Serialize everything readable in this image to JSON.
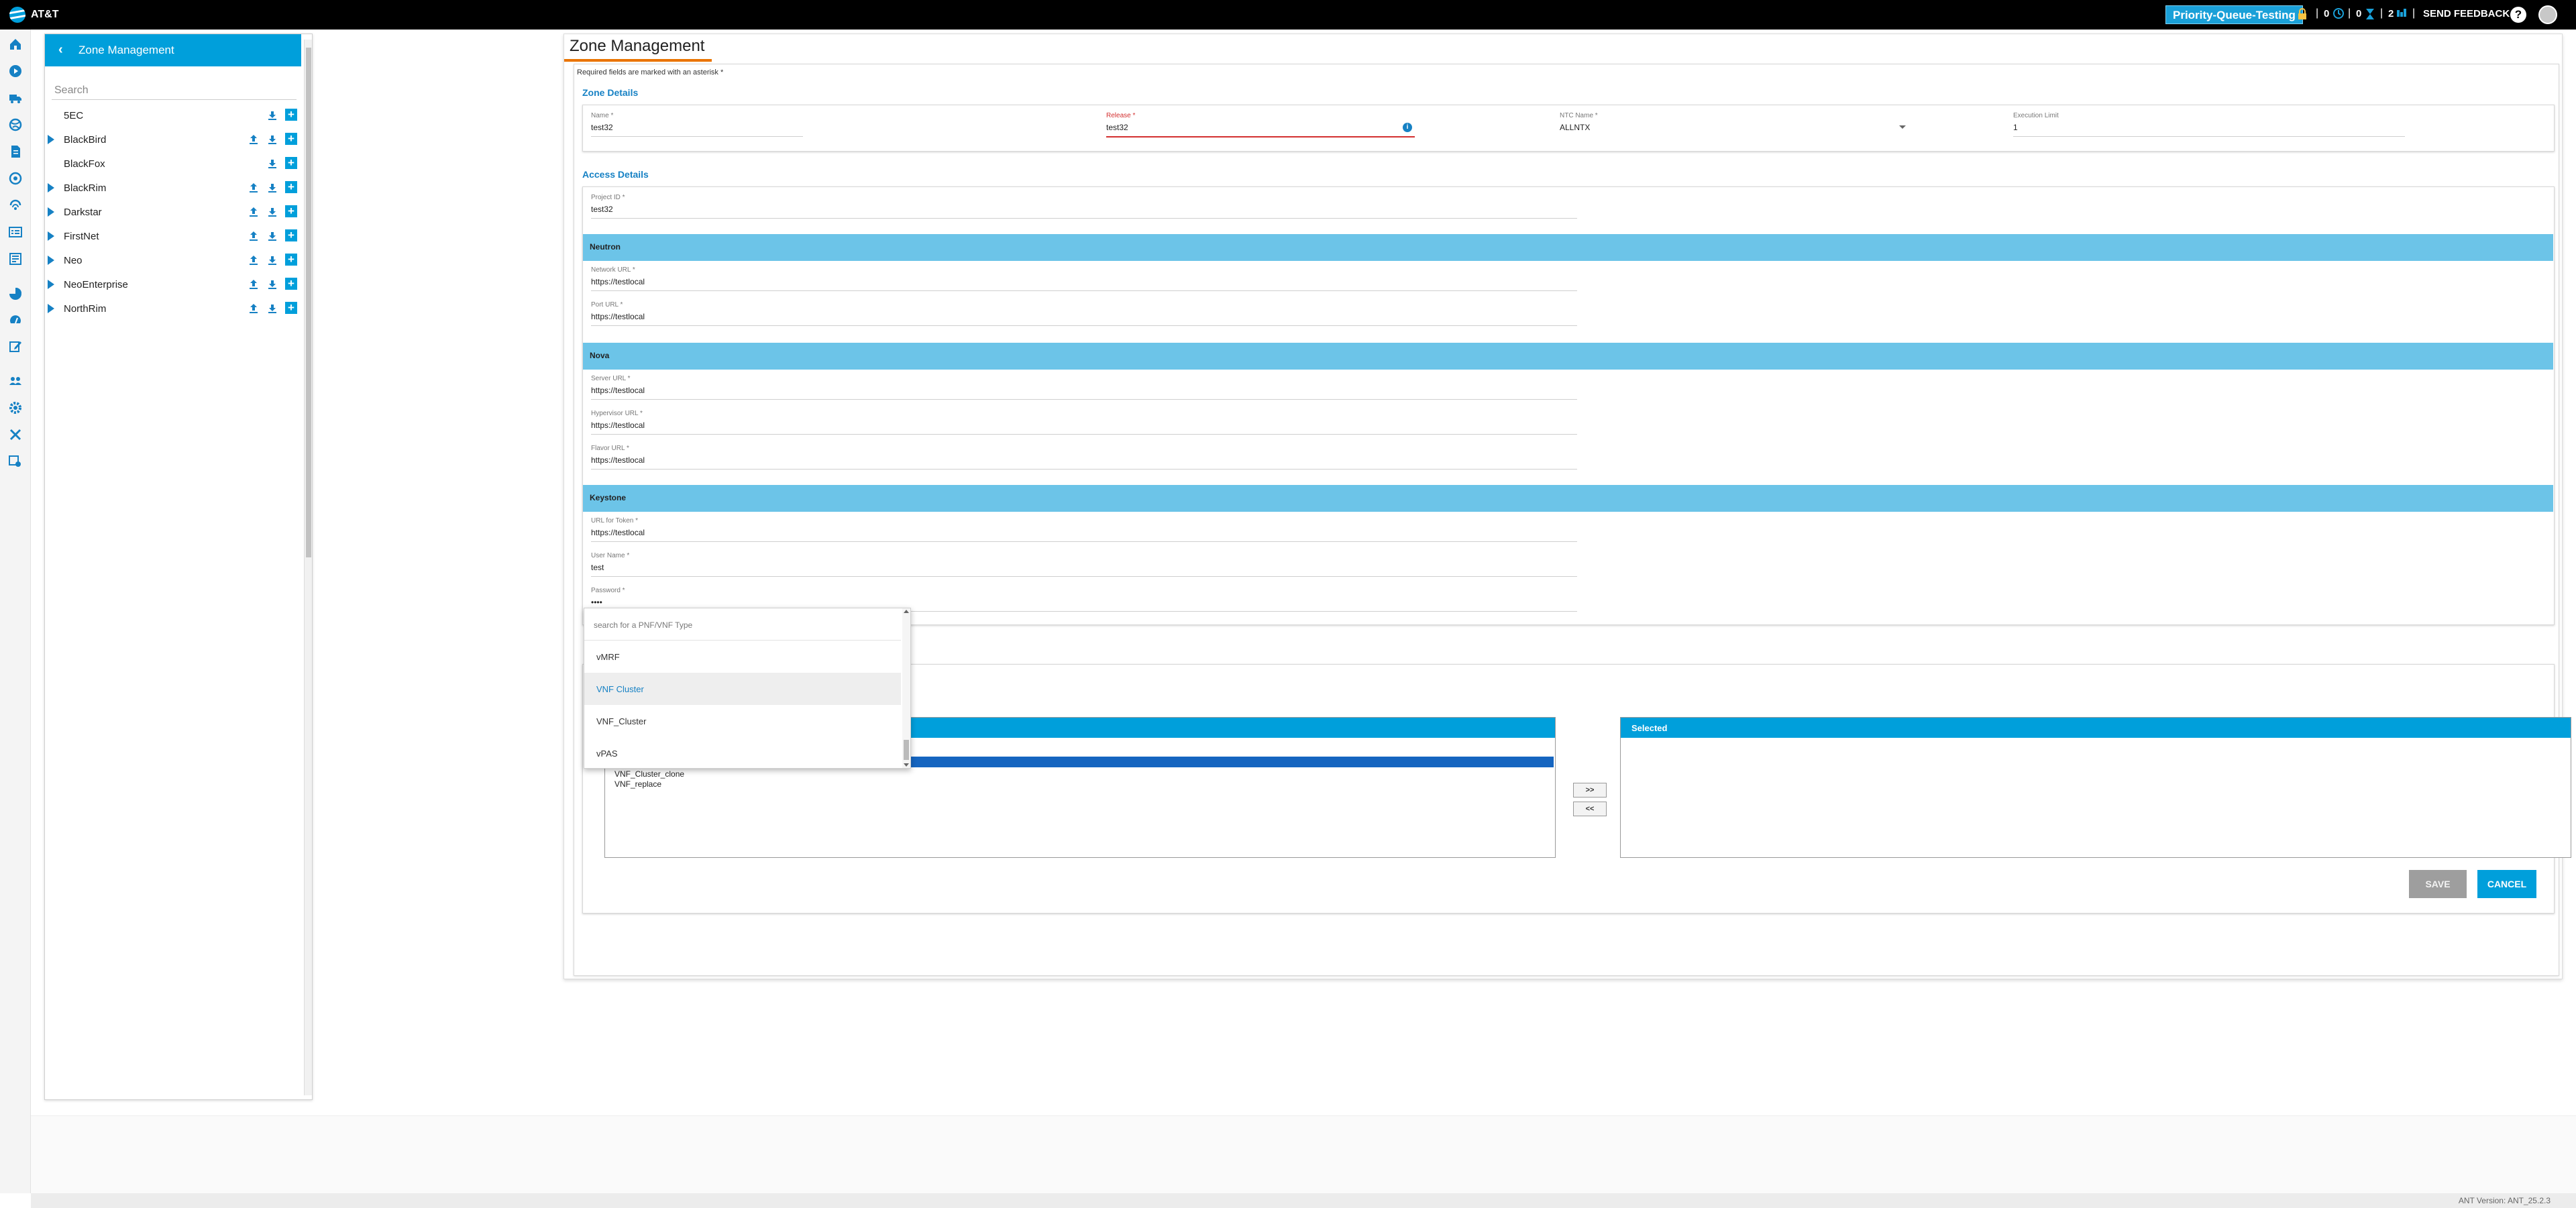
{
  "header": {
    "brand": "AT&T",
    "environment": "Priority-Queue-Testing",
    "count_a": "0",
    "count_b": "0",
    "count_c": "2",
    "send_feedback": "SEND FEEDBACK",
    "help_glyph": "?"
  },
  "rail": {
    "icons": [
      "home-icon",
      "play-icon",
      "truck-icon",
      "globe-icon",
      "document-icon",
      "network-icon",
      "satellite-icon",
      "server-list-icon",
      "dashboard-icon",
      "pie-chart-icon",
      "gauge-icon",
      "edit-icon",
      "team-icon",
      "settings-icon",
      "tools-icon",
      "config-icon"
    ],
    "expand_glyph": "»"
  },
  "tree": {
    "title": "Zone Management",
    "back_glyph": "‹",
    "search_placeholder": "Search",
    "add_glyph": "+",
    "items": [
      {
        "label": "5EC",
        "expandable": false,
        "upload": false
      },
      {
        "label": "BlackBird",
        "expandable": true,
        "upload": true
      },
      {
        "label": "BlackFox",
        "expandable": false,
        "upload": false
      },
      {
        "label": "BlackRim",
        "expandable": true,
        "upload": true
      },
      {
        "label": "Darkstar",
        "expandable": true,
        "upload": true
      },
      {
        "label": "FirstNet",
        "expandable": true,
        "upload": true
      },
      {
        "label": "Neo",
        "expandable": true,
        "upload": true
      },
      {
        "label": "NeoEnterprise",
        "expandable": true,
        "upload": true
      },
      {
        "label": "NorthRim",
        "expandable": true,
        "upload": true
      }
    ]
  },
  "page": {
    "title": "Zone Management",
    "required_note": "Required fields are marked with an asterisk *"
  },
  "zone_details": {
    "section": "Zone Details",
    "name_label": "Name *",
    "name_value": "test32",
    "release_label": "Release *",
    "release_value": "test32",
    "release_info_glyph": "i",
    "ntc_label": "NTC Name *",
    "ntc_value": "ALLNTX",
    "exec_label": "Execution Limit",
    "exec_value": "1"
  },
  "access_details": {
    "section": "Access Details",
    "project_label": "Project ID *",
    "project_value": "test32",
    "neutron_band": "Neutron",
    "network_label": "Network URL *",
    "network_value": "https://testlocal",
    "port_label": "Port URL *",
    "port_value": "https://testlocal",
    "nova_band": "Nova",
    "server_label": "Server URL *",
    "server_value": "https://testlocal",
    "hypervisor_label": "Hypervisor URL *",
    "hypervisor_value": "https://testlocal",
    "flavor_label": "Flavor URL *",
    "flavor_value": "https://testlocal",
    "keystone_band": "Keystone",
    "token_label": "URL for Token *",
    "token_value": "https://testlocal",
    "username_label": "User Name *",
    "username_value": "test",
    "password_label": "Password *",
    "password_value": "••••"
  },
  "dropdown": {
    "search_placeholder": "search for a PNF/VNF Type",
    "options": [
      "vMRF",
      "VNF Cluster",
      "VNF_Cluster",
      "vPAS"
    ],
    "highlighted": "VNF Cluster"
  },
  "vnf_lists": {
    "available_entries": [
      "VNF_Cluster_clone",
      "VNF_replace"
    ],
    "selected_header": "Selected",
    "move_right": ">>",
    "move_left": "<<"
  },
  "actions": {
    "save": "SAVE",
    "cancel": "CANCEL"
  },
  "status": {
    "version": "ANT Version: ANT_25.2.3"
  },
  "colors": {
    "accent": "#009fdb",
    "band": "#6cc4e8",
    "title_underline": "#ea7400",
    "error": "#d32f2f",
    "selection": "#1565c0"
  }
}
